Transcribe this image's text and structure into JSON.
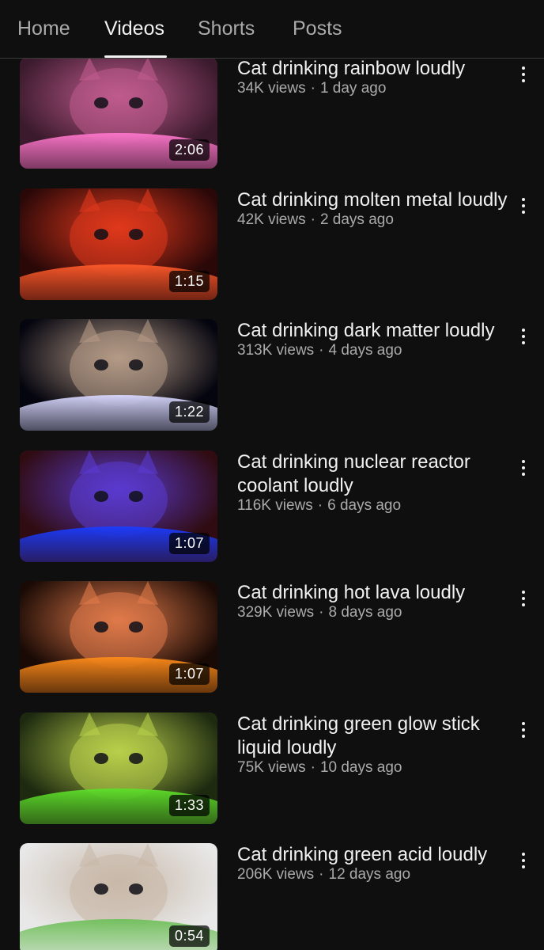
{
  "tabs": [
    {
      "label": "Home",
      "active": false
    },
    {
      "label": "Videos",
      "active": true
    },
    {
      "label": "Shorts",
      "active": false
    },
    {
      "label": "Posts",
      "active": false
    }
  ],
  "videos": [
    {
      "title": "Cat drinking rainbow loudly",
      "views": "34K views",
      "age": "1 day ago",
      "duration": "2:06",
      "thumb_colors": [
        "#c05b8e",
        "#3a1a2c",
        "#f7c"
      ]
    },
    {
      "title": "Cat drinking molten metal loudly",
      "views": "42K views",
      "age": "2 days ago",
      "duration": "1:15",
      "thumb_colors": [
        "#e0381c",
        "#2a0808",
        "#ff5a2a"
      ]
    },
    {
      "title": "Cat drinking dark matter loudly",
      "views": "313K views",
      "age": "4 days ago",
      "duration": "1:22",
      "thumb_colors": [
        "#b49a86",
        "#05050f",
        "#d8d8ff"
      ]
    },
    {
      "title": "Cat drinking nuclear reactor coolant loudly",
      "views": "116K views",
      "age": "6 days ago",
      "duration": "1:07",
      "thumb_colors": [
        "#5a3ad0",
        "#300c12",
        "#1a3cff"
      ]
    },
    {
      "title": "Cat drinking hot lava loudly",
      "views": "329K views",
      "age": "8 days ago",
      "duration": "1:07",
      "thumb_colors": [
        "#e07a4a",
        "#1a0a05",
        "#ff8c1a"
      ]
    },
    {
      "title": "Cat drinking green glow stick liquid loudly",
      "views": "75K views",
      "age": "10 days ago",
      "duration": "1:33",
      "thumb_colors": [
        "#b8d04a",
        "#1e2a10",
        "#5ee02a"
      ]
    },
    {
      "title": "Cat drinking green acid loudly",
      "views": "206K views",
      "age": "12 days ago",
      "duration": "0:54",
      "thumb_colors": [
        "#c8b8a8",
        "#e8e8e8",
        "#6fbf5a"
      ]
    }
  ],
  "meta_separator": "·"
}
